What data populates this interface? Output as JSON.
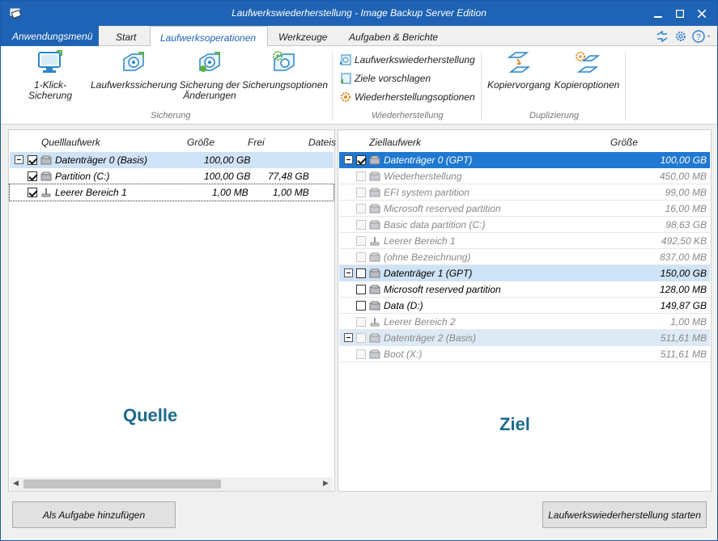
{
  "window": {
    "title": "Laufwerkswiederherstellung - Image Backup Server Edition",
    "app_icon": "app-logo-icon",
    "controls": [
      "minimize-icon",
      "maximize-icon",
      "close-icon"
    ]
  },
  "menu": {
    "app_menu": "Anwendungsmenü",
    "tabs": [
      "Start",
      "Laufwerksoperationen",
      "Werkzeuge",
      "Aufgaben & Berichte"
    ],
    "active_tab": "Laufwerksoperationen",
    "quick_icons": [
      "refresh-icon",
      "settings-gear-icon",
      "help-icon"
    ]
  },
  "ribbon": {
    "sicherung": {
      "label": "Sicherung",
      "buttons": [
        "1-Klick-Sicherung",
        "Laufwerkssicherung",
        "Sicherung der",
        "Änderungen",
        "Sicherungsoptionen"
      ]
    },
    "wiederherstellung": {
      "label": "Wiederherstellung",
      "buttons": [
        "Laufwerkswiederherstellung",
        "Ziele vorschlagen",
        "Wiederherstellungsoptionen"
      ]
    },
    "duplizierung": {
      "label": "Duplizierung",
      "buttons": [
        "Kopiervorgang",
        "Kopieroptionen"
      ]
    }
  },
  "source": {
    "headers": [
      "Quelllaufwerk",
      "Größe",
      "Frei",
      "Dateis"
    ],
    "rows": [
      {
        "name": "Datenträger 0 (Basis)",
        "size": "100,00 GB",
        "free": ""
      },
      {
        "name": "Partition (C:)",
        "size": "100,00 GB",
        "free": "77,48 GB"
      },
      {
        "name": "Leerer Bereich 1",
        "size": "1,00 MB",
        "free": "1,00 MB"
      }
    ],
    "watermark": "Quelle"
  },
  "target": {
    "headers": [
      "Ziellaufwerk",
      "Größe"
    ],
    "rows": [
      {
        "name": "Datenträger 0 (GPT)",
        "size": "100,00 GB"
      },
      {
        "name": "Wiederherstellung",
        "size": "450,00 MB"
      },
      {
        "name": "EFI system partition",
        "size": "99,00 MB"
      },
      {
        "name": "Microsoft reserved partition",
        "size": "16,00 MB"
      },
      {
        "name": "Basic data partition (C:)",
        "size": "98,63 GB"
      },
      {
        "name": "Leerer Bereich 1",
        "size": "492,50 KB"
      },
      {
        "name": "(ohne Bezeichnung)",
        "size": "837,00 MB"
      },
      {
        "name": "Datenträger 1 (GPT)",
        "size": "150,00 GB"
      },
      {
        "name": "Microsoft reserved partition",
        "size": "128,00 MB"
      },
      {
        "name": "Data (D:)",
        "size": "149,87 GB"
      },
      {
        "name": "Leerer Bereich 2",
        "size": "1,00 MB"
      },
      {
        "name": "Datenträger 2 (Basis)",
        "size": "511,61 MB"
      },
      {
        "name": "Boot (X:)",
        "size": "511,61 MB"
      }
    ],
    "watermark": "Ziel"
  },
  "buttons": {
    "add_task": "Als Aufgabe hinzufügen",
    "start": "Laufwerkswiederherstellung starten"
  }
}
